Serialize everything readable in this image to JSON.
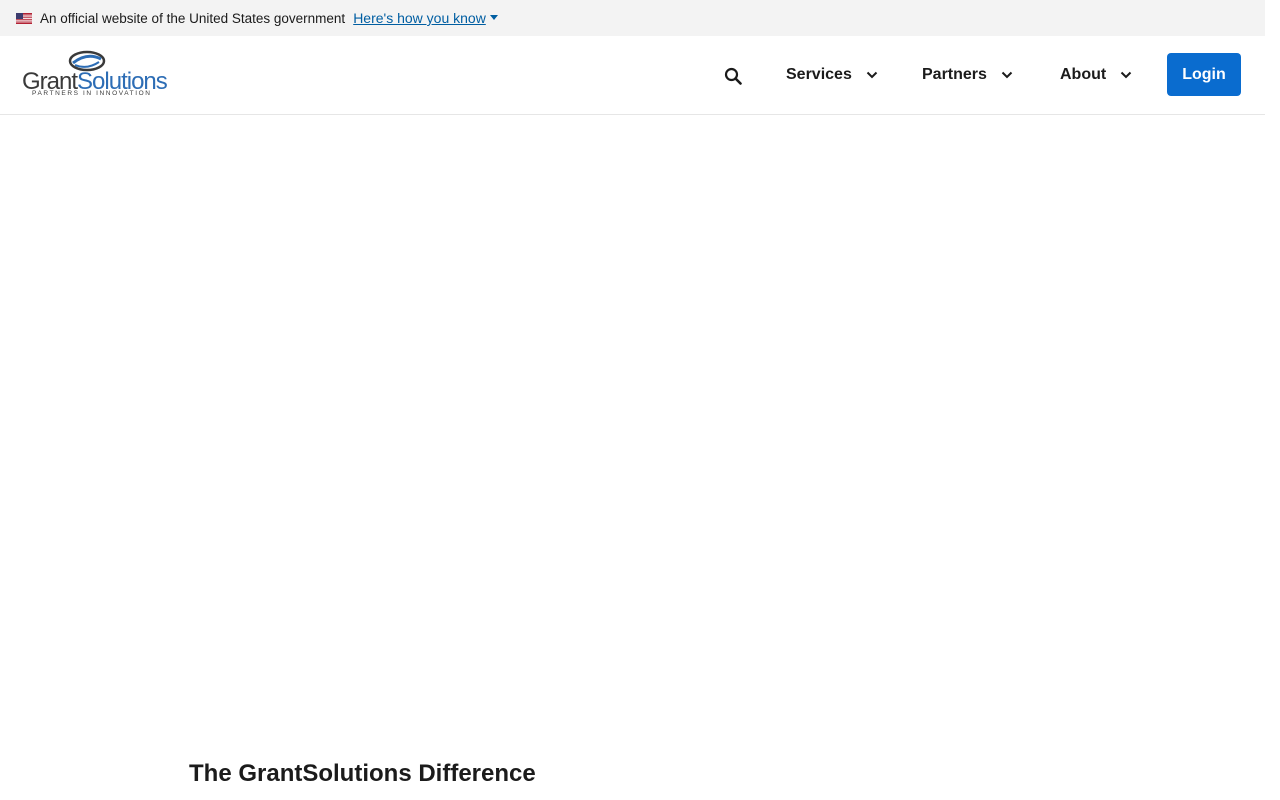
{
  "gov_banner": {
    "text": "An official website of the United States government",
    "link_label": "Here's how you know",
    "flag_icon": "us-flag-icon",
    "caret_icon": "caret-down-icon"
  },
  "header": {
    "logo": {
      "word_grant": "Grant",
      "word_solutions": "Solutions",
      "tagline": "PARTNERS IN INNOVATION"
    },
    "search_icon": "search-icon",
    "nav": [
      {
        "label": "Services",
        "icon": "chevron-down-icon"
      },
      {
        "label": "Partners",
        "icon": "chevron-down-icon"
      },
      {
        "label": "About",
        "icon": "chevron-down-icon"
      }
    ],
    "login_label": "Login"
  },
  "main": {
    "section_title": "The GrantSolutions Difference"
  },
  "colors": {
    "link": "#005ea2",
    "login_button": "#0a6ccf",
    "banner_bg": "#f3f3f3",
    "logo_blue": "#2d6db5"
  }
}
